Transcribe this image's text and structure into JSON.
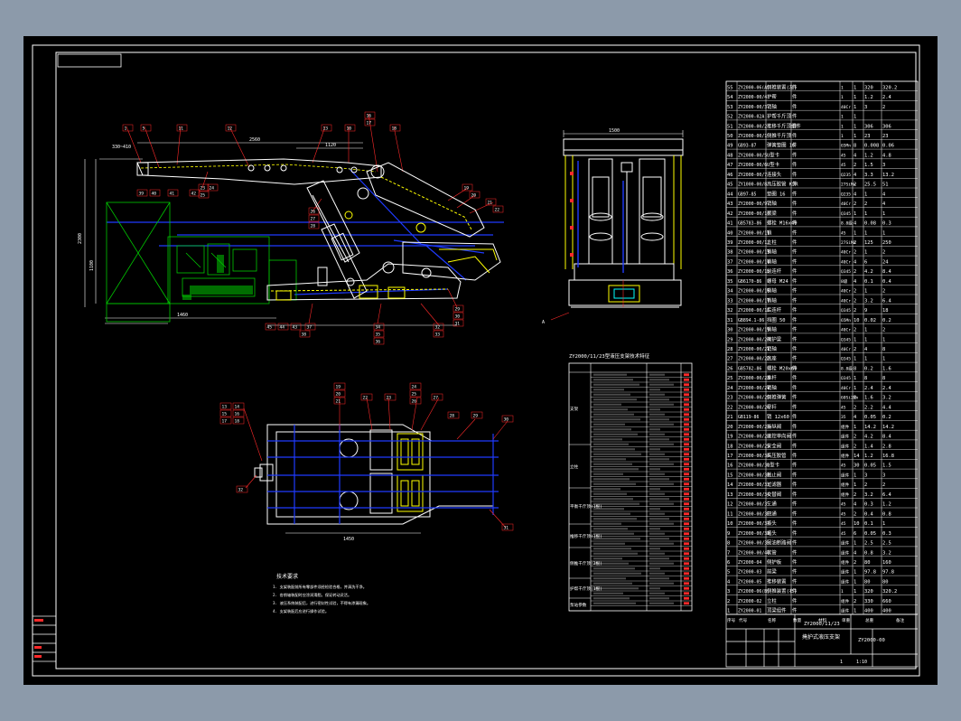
{
  "drawing": {
    "title_block": {
      "designation": "ZY2000/11/23",
      "name": "掩护式液压支架",
      "drawing_no": "ZY2000-00",
      "scale": "1:10",
      "sheet": "1"
    },
    "params_table_title": "ZY2000/11/23型液压支架技术特征",
    "params_groups": [
      "支架",
      "立柱",
      "平衡千斤顶(1根)",
      "推移千斤顶(1根)",
      "侧推千斤顶(2根)",
      "护帮千斤顶(1根)",
      "泵站参数"
    ],
    "notes_title": "技术要求",
    "notes": [
      "1. 支架装配前所有零部件须经检验合格，并清洗干净。",
      "2. 各销轴装配时应涂润滑脂，保证转动灵活。",
      "3. 液压系统装配后，进行密封性试验，不得有渗漏现象。",
      "4. 支架装配后应进行操作试验。"
    ],
    "dims": {
      "canopy_len": "2560",
      "front_span": "1120",
      "overall_h": "2300",
      "mid_h": "1100",
      "base_w": "1460",
      "section_w": "1500",
      "plan_w": "1450",
      "left_top": "330~410"
    },
    "callouts_side": [
      "1",
      "5",
      "11",
      "12",
      "13",
      "10",
      "16",
      "17",
      "18",
      "19",
      "20",
      "21",
      "22",
      "23",
      "24",
      "25",
      "26",
      "27",
      "28",
      "29",
      "30",
      "31",
      "32",
      "33",
      "34",
      "35",
      "36",
      "37",
      "38",
      "39",
      "40",
      "41",
      "42",
      "43",
      "44",
      "45",
      "46",
      "47",
      "48",
      "49",
      "50",
      "51",
      "52",
      "53",
      "54",
      "55"
    ],
    "callouts_plan": [
      "13",
      "14",
      "15",
      "16",
      "17",
      "18",
      "19",
      "20",
      "21",
      "22",
      "23",
      "24",
      "25",
      "26",
      "27",
      "28",
      "29",
      "30",
      "31",
      "32",
      "33",
      "34",
      "35",
      "36"
    ],
    "bom_header": [
      "序号",
      "代号",
      "名称",
      "数量",
      "材料",
      "单重",
      "总重",
      "备注"
    ],
    "bom_rows": [
      [
        "55",
        "ZY2000-06(A)",
        "侧推装置(左)",
        "件",
        "1",
        "1",
        "320",
        "320.2"
      ],
      [
        "54",
        "ZY2000-00/4",
        "护帮",
        "件",
        "1",
        "1",
        "1.2",
        "2.4"
      ],
      [
        "53",
        "ZY2000-00/3",
        "销轴",
        "件",
        "40Cr",
        "1",
        "3",
        "2"
      ],
      [
        "52",
        "ZY2000-02A",
        "护帮千斤顶",
        "件",
        "1",
        "1",
        "",
        ""
      ],
      [
        "51",
        "ZY2000-00/2",
        "推移千斤顶组件",
        "件",
        "1",
        "1",
        "306",
        "306"
      ],
      [
        "50",
        "ZY2000-00/1",
        "侧推千斤顶",
        "件",
        "1",
        "1",
        "23",
        "23"
      ],
      [
        "49",
        "GB93-87",
        "弹簧垫圈 16",
        "件",
        "65Mn",
        "8",
        "0.008",
        "0.06"
      ],
      [
        "48",
        "ZY2000-00/5",
        "U型卡",
        "件",
        "45",
        "4",
        "1.2",
        "4.8"
      ],
      [
        "47",
        "ZY2000-00/6",
        "U型卡",
        "件",
        "45",
        "2",
        "1.5",
        "3"
      ],
      [
        "46",
        "ZY2000-00/7",
        "连接头",
        "件",
        "Q235",
        "4",
        "3.3",
        "13.2"
      ],
      [
        "45",
        "ZY1000-00/8",
        "高压胶管 KJR",
        "件",
        "27SiMn",
        "2",
        "25.5",
        "51"
      ],
      [
        "44",
        "GB97-85",
        "垫圈 16",
        "件",
        "Q235",
        "4",
        "1",
        "4"
      ],
      [
        "43",
        "ZY2000-00/9",
        "销轴",
        "件",
        "40Cr",
        "2",
        "2",
        "4"
      ],
      [
        "42",
        "ZY2000-00/10",
        "顶梁",
        "件",
        "Q345",
        "1",
        "1",
        "1"
      ],
      [
        "41",
        "GB5783-86",
        "螺栓 M16x40",
        "件",
        "8.8级",
        "4",
        "0.08",
        "0.3"
      ],
      [
        "40",
        "ZY2000-00/11",
        "销",
        "件",
        "45",
        "1",
        "1",
        "1"
      ],
      [
        "39",
        "ZY2000-00/12",
        "立柱",
        "件",
        "27SiMn",
        "2",
        "125",
        "250"
      ],
      [
        "38",
        "ZY2000-00/13",
        "销轴",
        "件",
        "40Cr",
        "2",
        "1",
        "2"
      ],
      [
        "37",
        "ZY2000-00/14",
        "销轴",
        "件",
        "40Cr",
        "4",
        "6",
        "24"
      ],
      [
        "36",
        "ZY2000-00/15",
        "前连杆",
        "件",
        "Q345",
        "2",
        "4.2",
        "8.4"
      ],
      [
        "35",
        "GB6170-86",
        "螺母 M24",
        "件",
        "8级",
        "4",
        "0.1",
        "0.4"
      ],
      [
        "34",
        "ZY2000-00/16",
        "销轴",
        "件",
        "40Cr",
        "2",
        "1",
        "2"
      ],
      [
        "33",
        "ZY2000-00/17",
        "销轴",
        "件",
        "40Cr",
        "2",
        "3.2",
        "6.4"
      ],
      [
        "32",
        "ZY2000-00/18",
        "后连杆",
        "件",
        "Q345",
        "2",
        "9",
        "18"
      ],
      [
        "31",
        "GB894.1-86",
        "挡圈 50",
        "件",
        "65Mn",
        "10",
        "0.02",
        "0.2"
      ],
      [
        "30",
        "ZY2000-00/19",
        "销轴",
        "件",
        "40Cr",
        "2",
        "1",
        "2"
      ],
      [
        "29",
        "ZY2000-00/20",
        "掩护梁",
        "件",
        "Q345",
        "1",
        "1",
        "1"
      ],
      [
        "28",
        "ZY2000-00/21",
        "销轴",
        "件",
        "40Cr",
        "2",
        "4",
        "8"
      ],
      [
        "27",
        "ZY2000-00/22",
        "底座",
        "件",
        "Q345",
        "1",
        "1",
        "1"
      ],
      [
        "26",
        "GB5782-86",
        "螺栓 M20x60",
        "件",
        "8.8级",
        "8",
        "0.2",
        "1.6"
      ],
      [
        "25",
        "ZY2000-00/23",
        "推杆",
        "件",
        "Q345",
        "1",
        "8",
        "8"
      ],
      [
        "24",
        "ZY2000-00/24",
        "销轴",
        "件",
        "40Cr",
        "1",
        "2.4",
        "2.4"
      ],
      [
        "23",
        "ZY2000-00/25",
        "侧推弹簧",
        "件",
        "60Si2Mn",
        "2",
        "1.6",
        "3.2"
      ],
      [
        "22",
        "ZY2000-00/26",
        "导杆",
        "件",
        "45",
        "2",
        "2.2",
        "4.4"
      ],
      [
        "21",
        "GB119-86",
        "销 12x60",
        "件",
        "35",
        "4",
        "0.05",
        "0.2"
      ],
      [
        "20",
        "ZY2000-00/27",
        "操纵阀",
        "件",
        "组件",
        "1",
        "14.2",
        "14.2"
      ],
      [
        "19",
        "ZY2000-00/28",
        "液控单向阀",
        "件",
        "组件",
        "2",
        "4.2",
        "8.4"
      ],
      [
        "18",
        "ZY2000-00/29",
        "安全阀",
        "件",
        "组件",
        "2",
        "1.4",
        "2.8"
      ],
      [
        "17",
        "ZY2000-00/30",
        "高压胶管",
        "件",
        "组件",
        "14",
        "1.2",
        "16.8"
      ],
      [
        "16",
        "ZY2000-00/31",
        "U型卡",
        "件",
        "45",
        "30",
        "0.05",
        "1.5"
      ],
      [
        "15",
        "ZY2000-00/32",
        "截止阀",
        "件",
        "组件",
        "1",
        "3",
        "3"
      ],
      [
        "14",
        "ZY2000-00/33",
        "过滤器",
        "件",
        "组件",
        "1",
        "2",
        "2"
      ],
      [
        "13",
        "ZY2000-00/34",
        "交替阀",
        "件",
        "组件",
        "2",
        "3.2",
        "6.4"
      ],
      [
        "12",
        "ZY2000-00/35",
        "三通",
        "件",
        "45",
        "4",
        "0.3",
        "1.2"
      ],
      [
        "11",
        "ZY2000-00/36",
        "四通",
        "件",
        "45",
        "2",
        "0.4",
        "0.8"
      ],
      [
        "10",
        "ZY2000-00/37",
        "接头",
        "件",
        "45",
        "10",
        "0.1",
        "1"
      ],
      [
        "9",
        "ZY2000-00/38",
        "堵头",
        "件",
        "45",
        "6",
        "0.05",
        "0.3"
      ],
      [
        "8",
        "ZY2000-00/39",
        "回油断路阀",
        "件",
        "组件",
        "1",
        "2.5",
        "2.5"
      ],
      [
        "7",
        "ZY2000-00/40",
        "软管",
        "件",
        "组件",
        "4",
        "0.8",
        "3.2"
      ],
      [
        "6",
        "ZY2000-04",
        "侧护板",
        "件",
        "组件",
        "2",
        "80",
        "160"
      ],
      [
        "5",
        "ZY2000-03",
        "前梁",
        "件",
        "组件",
        "1",
        "97.8",
        "97.8"
      ],
      [
        "4",
        "ZY2000-05",
        "推移装置",
        "件",
        "组件",
        "1",
        "80",
        "80"
      ],
      [
        "3",
        "ZY2000-06(B)",
        "侧推装置(右)",
        "件",
        "1",
        "1",
        "320",
        "320.2"
      ],
      [
        "2",
        "ZY2000-02",
        "立柱",
        "件",
        "组件",
        "2",
        "330",
        "660"
      ],
      [
        "1",
        "ZY2000-01",
        "顶梁组件",
        "件",
        "组件",
        "1",
        "400",
        "400"
      ]
    ],
    "colors": {
      "line": "#ffffff",
      "yellow": "#ffff00",
      "blue": "#1f3bff",
      "green": "#00c800",
      "red": "#ff2a2a",
      "cyan": "#00ffff",
      "magenta": "#ff00ff"
    }
  }
}
